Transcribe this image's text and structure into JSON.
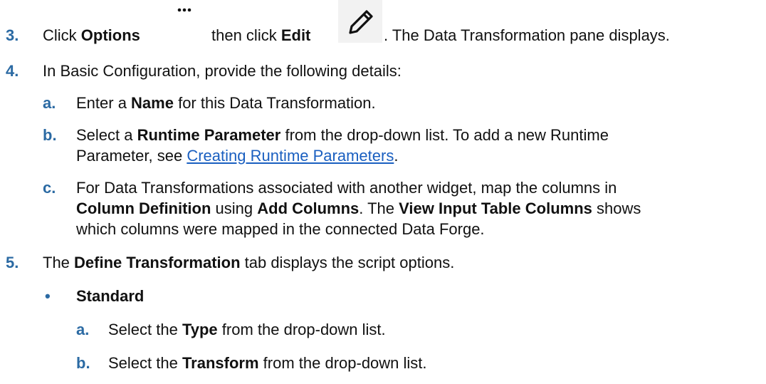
{
  "colors": {
    "step_number": "#2b6aa3",
    "link": "#1a5fc0",
    "text": "#111111"
  },
  "steps": {
    "s3": {
      "num": "3.",
      "t1": "Click ",
      "b1": "Options",
      "options_icon": "more-horizontal-icon",
      "t2": "then click ",
      "b2": "Edit",
      "edit_icon": "pencil-edit-icon",
      "t3": ". The Data Transformation pane displays."
    },
    "s4": {
      "num": "4.",
      "text": "In Basic Configuration, provide the following details:",
      "a": {
        "num": "a.",
        "t1": "Enter a ",
        "b1": "Name",
        "t2": " for this Data Transformation."
      },
      "b": {
        "num": "b.",
        "t1": "Select a ",
        "b1": "Runtime Parameter",
        "t2": " from the drop-down list. To add a new Runtime",
        "t3": "Parameter, see ",
        "link": "Creating Runtime Parameters",
        "t4": "."
      },
      "c": {
        "num": "c.",
        "l1": "For Data Transformations associated with another widget, map the columns in",
        "b1": "Column Definition",
        "t2": " using ",
        "b2": "Add Columns",
        "t3": ". The ",
        "b3": "View Input Table Columns",
        "t4": " shows",
        "l3": "which columns were mapped in the connected Data Forge."
      }
    },
    "s5": {
      "num": "5.",
      "t1": "The ",
      "b1": "Define Transformation",
      "t2": " tab displays the script options.",
      "bullet": "•",
      "standard": "Standard",
      "a": {
        "num": "a.",
        "t1": "Select the ",
        "b1": "Type",
        "t2": " from the drop-down list."
      },
      "b": {
        "num": "b.",
        "t1": "Select the ",
        "b1": "Transform",
        "t2": " from the drop-down list."
      }
    }
  }
}
